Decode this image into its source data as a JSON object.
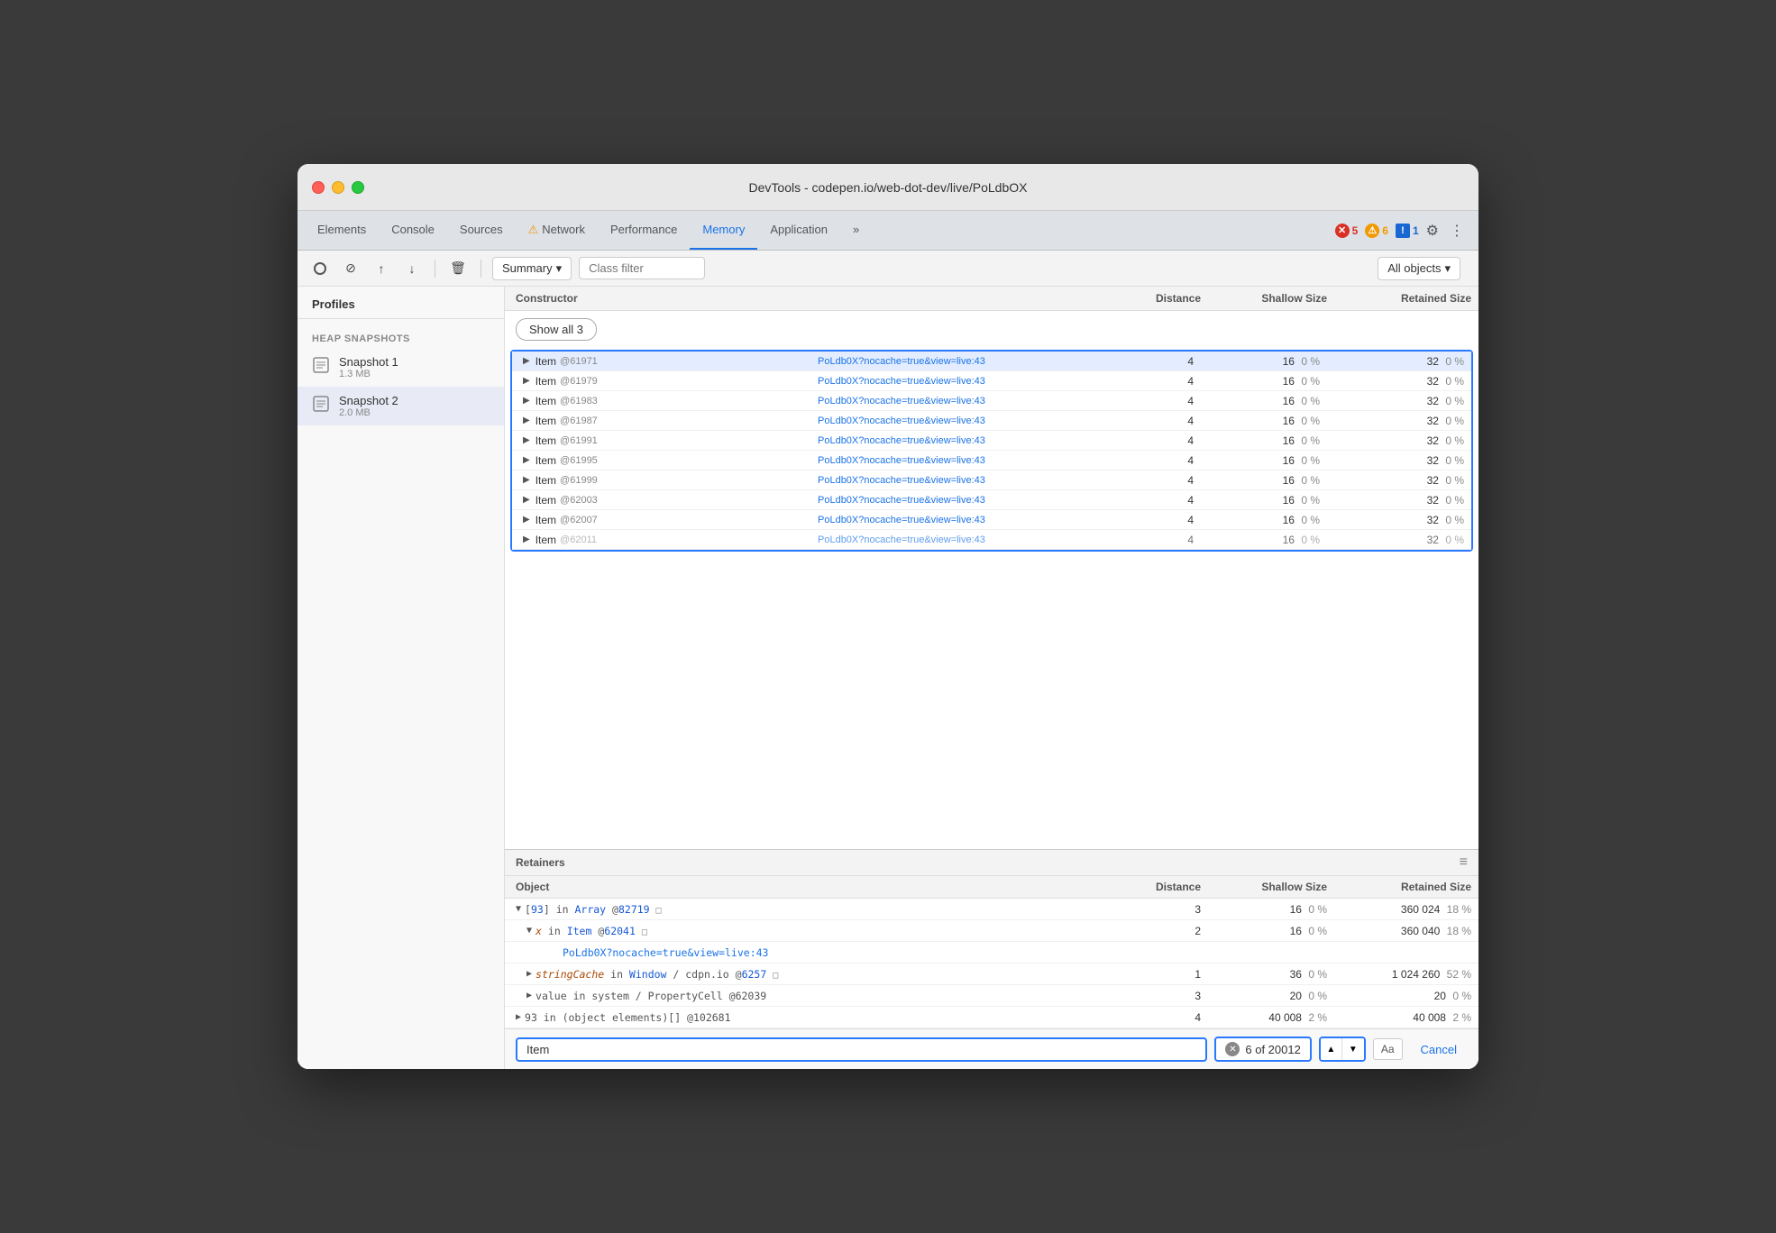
{
  "window": {
    "title": "DevTools - codepen.io/web-dot-dev/live/PoLdbOX"
  },
  "tabs": [
    {
      "id": "elements",
      "label": "Elements",
      "active": false
    },
    {
      "id": "console",
      "label": "Console",
      "active": false
    },
    {
      "id": "sources",
      "label": "Sources",
      "active": false
    },
    {
      "id": "network",
      "label": "Network",
      "active": false,
      "warning": true
    },
    {
      "id": "performance",
      "label": "Performance",
      "active": false
    },
    {
      "id": "memory",
      "label": "Memory",
      "active": true
    },
    {
      "id": "application",
      "label": "Application",
      "active": false
    }
  ],
  "badges": {
    "errors": {
      "icon": "✕",
      "count": "5"
    },
    "warnings": {
      "icon": "⚠",
      "count": "6"
    },
    "info": {
      "icon": "!",
      "count": "1"
    }
  },
  "toolbar": {
    "summary_label": "Summary",
    "class_filter_placeholder": "Class filter",
    "all_objects_label": "All objects",
    "record_tooltip": "Take heap snapshot",
    "clear_tooltip": "Clear all profiles",
    "upload_tooltip": "Load profile",
    "download_tooltip": "Save profile",
    "delete_tooltip": "Delete selected"
  },
  "sidebar": {
    "profiles_title": "Profiles",
    "heap_snapshots_title": "HEAP SNAPSHOTS",
    "snapshots": [
      {
        "id": "snapshot1",
        "name": "Snapshot 1",
        "size": "1.3 MB"
      },
      {
        "id": "snapshot2",
        "name": "Snapshot 2",
        "size": "2.0 MB",
        "selected": true
      }
    ]
  },
  "constructor_table": {
    "title": "Constructor",
    "columns": {
      "constructor": "Constructor",
      "distance": "Distance",
      "shallow_size": "Shallow Size",
      "retained_size": "Retained Size"
    },
    "show_all_button": "Show all 3",
    "rows": [
      {
        "id": "r1",
        "name": "Item",
        "at_id": "@61971",
        "link": "PoLdb0X?nocache=true&view=live:43",
        "distance": "4",
        "shallow": "16",
        "shallow_pct": "0 %",
        "retained": "32",
        "retained_pct": "0 %",
        "selected": true
      },
      {
        "id": "r2",
        "name": "Item",
        "at_id": "@61979",
        "link": "PoLdb0X?nocache=true&view=live:43",
        "distance": "4",
        "shallow": "16",
        "shallow_pct": "0 %",
        "retained": "32",
        "retained_pct": "0 %",
        "selected": true
      },
      {
        "id": "r3",
        "name": "Item",
        "at_id": "@61983",
        "link": "PoLdb0X?nocache=true&view=live:43",
        "distance": "4",
        "shallow": "16",
        "shallow_pct": "0 %",
        "retained": "32",
        "retained_pct": "0 %",
        "selected": true
      },
      {
        "id": "r4",
        "name": "Item",
        "at_id": "@61987",
        "link": "PoLdb0X?nocache=true&view=live:43",
        "distance": "4",
        "shallow": "16",
        "shallow_pct": "0 %",
        "retained": "32",
        "retained_pct": "0 %",
        "selected": true
      },
      {
        "id": "r5",
        "name": "Item",
        "at_id": "@61991",
        "link": "PoLdb0X?nocache=true&view=live:43",
        "distance": "4",
        "shallow": "16",
        "shallow_pct": "0 %",
        "retained": "32",
        "retained_pct": "0 %",
        "selected": true
      },
      {
        "id": "r6",
        "name": "Item",
        "at_id": "@61995",
        "link": "PoLdb0X?nocache=true&view=live:43",
        "distance": "4",
        "shallow": "16",
        "shallow_pct": "0 %",
        "retained": "32",
        "retained_pct": "0 %",
        "selected": true
      },
      {
        "id": "r7",
        "name": "Item",
        "at_id": "@61999",
        "link": "PoLdb0X?nocache=true&view=live:43",
        "distance": "4",
        "shallow": "16",
        "shallow_pct": "0 %",
        "retained": "32",
        "retained_pct": "0 %",
        "selected": true
      },
      {
        "id": "r8",
        "name": "Item",
        "at_id": "@62003",
        "link": "PoLdb0X?nocache=true&view=live:43",
        "distance": "4",
        "shallow": "16",
        "shallow_pct": "0 %",
        "retained": "32",
        "retained_pct": "0 %",
        "selected": true
      },
      {
        "id": "r9",
        "name": "Item",
        "at_id": "@62007",
        "link": "PoLdb0X?nocache=true&view=live:43",
        "distance": "4",
        "shallow": "16",
        "shallow_pct": "0 %",
        "retained": "32",
        "retained_pct": "0 %",
        "selected": true
      },
      {
        "id": "r10",
        "name": "Item",
        "at_id": "@62011",
        "link": "PoLdb0X?nocache=true&view=live:43",
        "distance": "4",
        "shallow": "16",
        "shallow_pct": "0 %",
        "retained": "32",
        "retained_pct": "0 %",
        "selected": true
      }
    ]
  },
  "retainers": {
    "title": "Retainers",
    "columns": {
      "object": "Object",
      "distance": "Distance",
      "shallow_size": "Shallow Size",
      "retained_size": "Retained Size"
    },
    "rows": [
      {
        "id": "ret1",
        "indent": 0,
        "expand": true,
        "content": "[93] in Array @82719",
        "special": "□",
        "distance": "3",
        "shallow": "16",
        "shallow_pct": "0 %",
        "retained": "360 024",
        "retained_pct": "18 %"
      },
      {
        "id": "ret2",
        "indent": 1,
        "expand": true,
        "content": "x in Item @62041",
        "special": "□",
        "distance": "2",
        "shallow": "16",
        "shallow_pct": "0 %",
        "retained": "360 040",
        "retained_pct": "18 %"
      },
      {
        "id": "ret3",
        "indent": 2,
        "expand": false,
        "link": "PoLdb0X?nocache=true&view=live:43",
        "distance": "",
        "shallow": "",
        "shallow_pct": "",
        "retained": "",
        "retained_pct": ""
      },
      {
        "id": "ret4",
        "indent": 1,
        "expand": true,
        "content": "stringCache in Window / cdpn.io @6257",
        "special": "□",
        "distance": "1",
        "shallow": "36",
        "shallow_pct": "0 %",
        "retained": "1 024 260",
        "retained_pct": "52 %"
      },
      {
        "id": "ret5",
        "indent": 1,
        "expand": true,
        "content": "value in system / PropertyCell @62039",
        "distance": "3",
        "shallow": "20",
        "shallow_pct": "0 %",
        "retained": "20",
        "retained_pct": "0 %"
      },
      {
        "id": "ret6",
        "indent": 0,
        "expand": true,
        "content": "93 in (object elements)[] @102681",
        "distance": "4",
        "shallow": "40 008",
        "shallow_pct": "2 %",
        "retained": "40 008",
        "retained_pct": "2 %"
      }
    ]
  },
  "search": {
    "input_value": "Item",
    "result_count": "6 of 20012",
    "total": "20012",
    "current": "6",
    "aa_label": "Aa",
    "cancel_label": "Cancel"
  }
}
